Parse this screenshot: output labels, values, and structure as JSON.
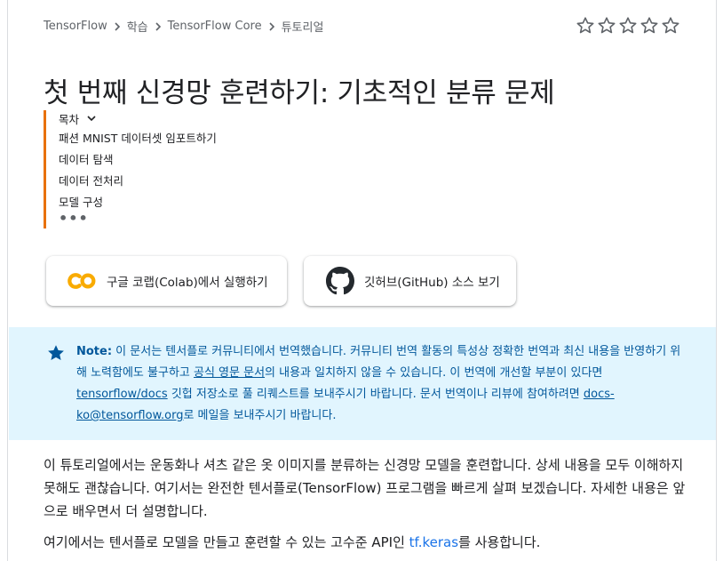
{
  "breadcrumb": {
    "items": [
      "TensorFlow",
      "학습",
      "TensorFlow Core",
      "튜토리얼"
    ]
  },
  "rating": {
    "stars_total": 5,
    "stars_filled": 0
  },
  "title": "첫 번째 신경망 훈련하기: 기초적인 분류 문제",
  "toc": {
    "header": "목차",
    "items": [
      "패션 MNIST 데이터셋 임포트하기",
      "데이터 탐색",
      "데이터 전처리",
      "모델 구성"
    ],
    "more": "•••"
  },
  "buttons": {
    "colab": "구글 코랩(Colab)에서 실행하기",
    "github": "깃허브(GitHub) 소스 보기"
  },
  "note": {
    "label": "Note:",
    "text1": " 이 문서는 텐서플로 커뮤니티에서 번역했습니다. 커뮤니티 번역 활동의 특성상 정확한 번역과 최신 내용을 반영하기 위해 노력함에도 불구하고 ",
    "link1": "공식 영문 문서",
    "text2": "의 내용과 일치하지 않을 수 있습니다. 이 번역에 개선할 부분이 있다면 ",
    "link2": "tensorflow/docs",
    "text3": " 깃헙 저장소로 풀 리퀘스트를 보내주시기 바랍니다. 문서 번역이나 리뷰에 참여하려면 ",
    "link3": "docs-ko@tensorflow.org",
    "text4": "로 메일을 보내주시기 바랍니다."
  },
  "body": {
    "para1": "이 튜토리얼에서는 운동화나 셔츠 같은 옷 이미지를 분류하는 신경망 모델을 훈련합니다. 상세 내용을 모두 이해하지 못해도 괜찮습니다. 여기서는 완전한 텐서플로(TensorFlow) 프로그램을 빠르게 살펴 보겠습니다. 자세한 내용은 앞으로 배우면서 더 설명합니다.",
    "para2_a": "여기에서는 텐서플로 모델을 만들고 훈련할 수 있는 고수준 API인 ",
    "para2_link": "tf.keras",
    "para2_b": "를 사용합니다."
  },
  "colors": {
    "note_bg": "#e1f5fe",
    "note_text": "#01579b",
    "toc_accent": "#e8710a",
    "link": "#1a73e8",
    "colab_orange": "#f9ab00"
  }
}
